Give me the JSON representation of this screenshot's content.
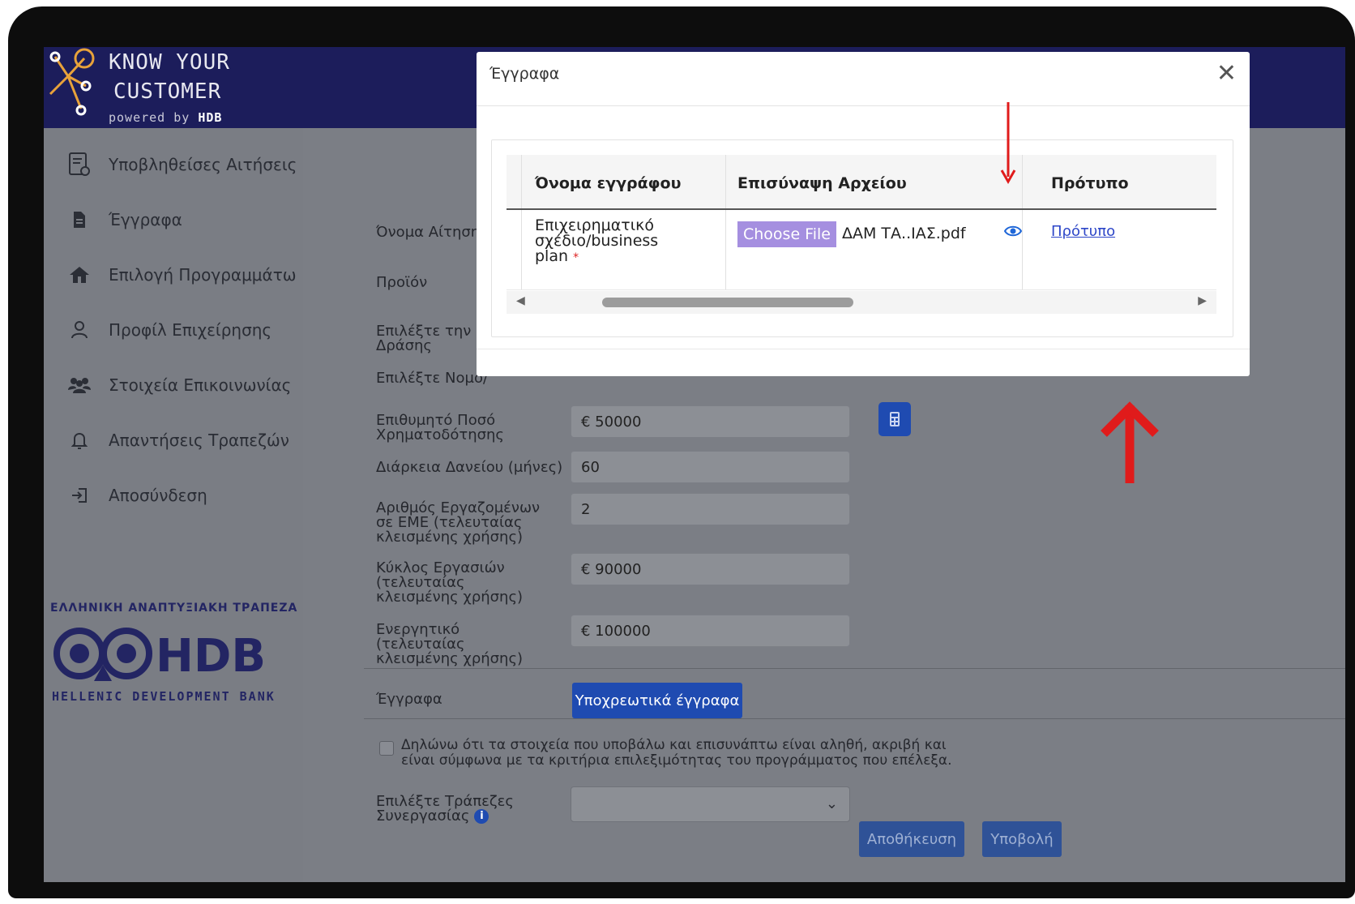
{
  "brand": {
    "line1": "KNOW YOUR",
    "line2": "CUSTOMER",
    "powered_prefix": "powered by ",
    "powered_brand": "HDB"
  },
  "sidebar": {
    "items": [
      {
        "label": "Υποβληθείσες Αιτήσεις",
        "icon": "document-check-icon"
      },
      {
        "label": "Έγγραφα",
        "icon": "file-icon"
      },
      {
        "label": "Επιλογή Προγραμμάτω",
        "icon": "house-icon"
      },
      {
        "label": "Προφίλ Επιχείρησης",
        "icon": "user-icon"
      },
      {
        "label": "Στοιχεία Επικοινωνίας",
        "icon": "users-icon"
      },
      {
        "label": "Απαντήσεις Τραπεζών",
        "icon": "bell-icon"
      },
      {
        "label": "Αποσύνδεση",
        "icon": "logout-icon"
      }
    ],
    "bank_name_gr": "ΕΛΛΗΝΙΚΗ ΑΝΑΠΤΥΞΙΑΚΗ ΤΡΑΠΕΖΑ",
    "bank_name_en": "HELLENIC DEVELOPMENT BANK"
  },
  "form": {
    "labels": {
      "application_name": "Όνομα Αίτησης",
      "product": "Προϊόν",
      "category": "Επιλέξτε την Κα Δράσης",
      "region": "Επιλέξτε Νομό/",
      "amount": "Επιθυμητό Ποσό Χρηματοδότησης",
      "duration": "Διάρκεια Δανείου (μήνες)",
      "employees": "Αριθμός Εργαζομένων σε ΕΜΕ (τελευταίας κλεισμένης χρήσης)",
      "turnover": "Κύκλος Εργασιών (τελευταίας κλεισμένης χρήσης)",
      "assets": "Ενεργητικό (τελευταίας κλεισμένης χρήσης)",
      "documents": "Έγγραφα",
      "banks": "Επιλέξτε Τράπεζες Συνεργασίας"
    },
    "values": {
      "amount": "€ 50000",
      "duration": "60",
      "employees": "2",
      "turnover": "€ 90000",
      "assets": "€ 100000"
    },
    "documents_button": "Υποχρεωτικά έγγραφα",
    "declaration": "Δηλώνω ότι τα στοιχεία που υποβάλω και επισυνάπτω είναι αληθή, ακριβή και είναι σύμφωνα με τα κριτήρια επιλεξιμότητας του προγράμματος που επέλεξα.",
    "info_glyph": "i",
    "save_button": "Αποθήκευση",
    "submit_button": "Υποβολή"
  },
  "modal": {
    "title": "Έγγραφα",
    "close_glyph": "✕",
    "columns": [
      "Όνομα εγγράφου",
      "Επισύναψη Αρχείου",
      "Πρότυπο"
    ],
    "row": {
      "document_name": "Επιχειρηματικό σχέδιο/business plan",
      "required_mark": "*",
      "choose_file": "Choose File",
      "file_name": "ΔΑΜ ΤΑ..ΙΑΣ.pdf",
      "template_link": "Πρότυπο"
    }
  },
  "colors": {
    "brand_navy": "#1c1d5b",
    "primary_button": "#1f4bb1",
    "annotation_red": "#e01b1b"
  }
}
